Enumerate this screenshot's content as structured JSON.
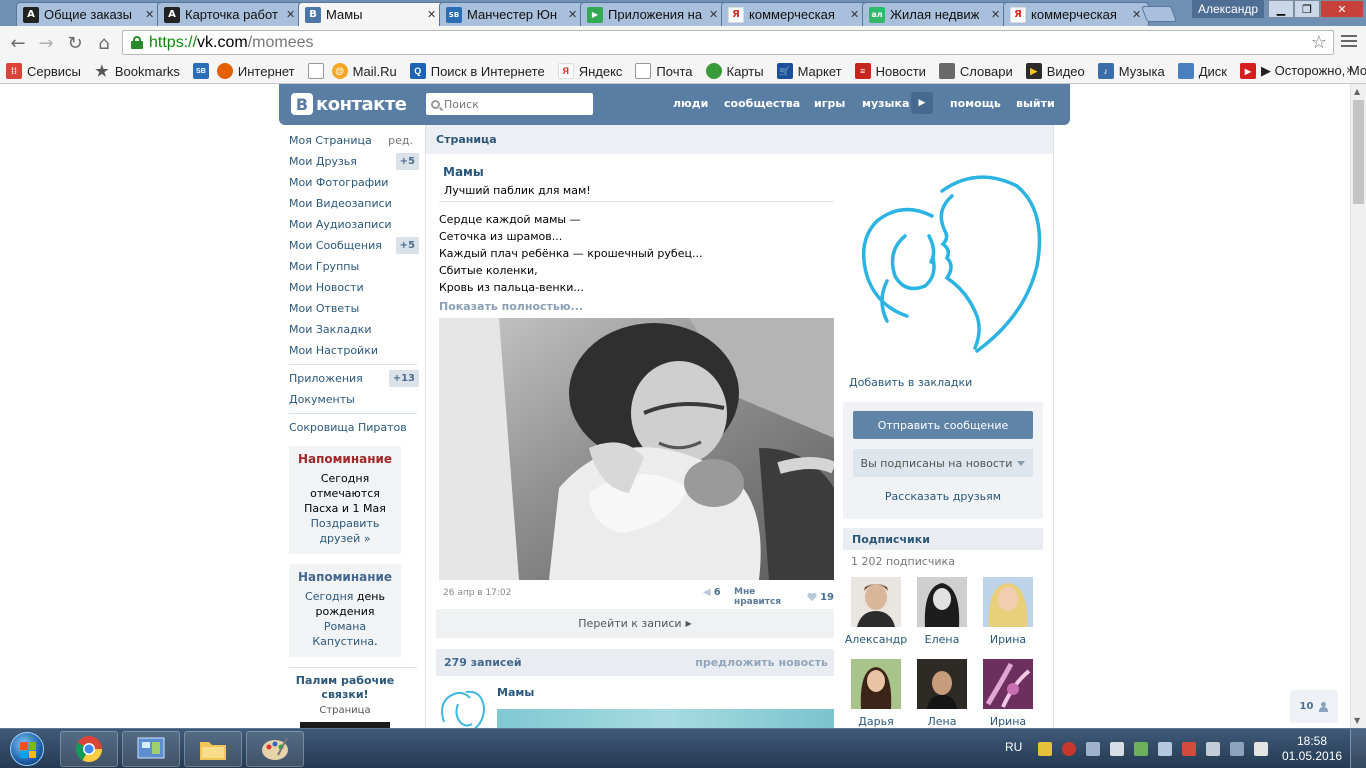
{
  "browser": {
    "tabs": [
      {
        "title": "Общие заказы",
        "icon": "A",
        "icon_color": "#222222",
        "active": false
      },
      {
        "title": "Карточка работ",
        "icon": "A",
        "icon_color": "#222222",
        "active": false
      },
      {
        "title": "Мамы",
        "icon": "В",
        "icon_color": "#4a76a8",
        "active": true
      },
      {
        "title": "Манчестер Юн",
        "icon": "SB",
        "icon_color": "#2a6fb5",
        "active": false
      },
      {
        "title": "Приложения на",
        "icon": "▶",
        "icon_color": "#34a853",
        "active": false
      },
      {
        "title": "коммерческая",
        "icon": "Я",
        "icon_color": "#e52620",
        "active": false
      },
      {
        "title": "Жилая недвиж",
        "icon": "ал",
        "icon_color": "#33b86b",
        "active": false
      },
      {
        "title": "коммерческая",
        "icon": "Я",
        "icon_color": "#e52620",
        "active": false
      }
    ],
    "user": "Александр",
    "url_scheme": "https://",
    "url_host": "vk.com",
    "url_path": "/momees",
    "bookmarks": [
      {
        "label": "Сервисы",
        "icon": "apps-icon",
        "color": "#d64537"
      },
      {
        "label": "Bookmarks",
        "icon": "star-icon",
        "color": "#555555"
      },
      {
        "label": "",
        "icon": "sb-icon",
        "color": "#2a6fb5"
      },
      {
        "label": "Интернет",
        "icon": "firefox-icon",
        "color": "#e66000"
      },
      {
        "label": "",
        "icon": "page-icon",
        "color": "#888888"
      },
      {
        "label": "Mail.Ru",
        "icon": "mailru-icon",
        "color": "#168de2"
      },
      {
        "label": "Поиск в Интернете",
        "icon": "search-icon",
        "color": "#1e63b5"
      },
      {
        "label": "Яндекс",
        "icon": "yandex-icon",
        "color": "#e52620"
      },
      {
        "label": "Почта",
        "icon": "page-icon",
        "color": "#888888"
      },
      {
        "label": "Карты",
        "icon": "maps-icon",
        "color": "#3a9a3a"
      },
      {
        "label": "Маркет",
        "icon": "cart-icon",
        "color": "#1b4f9c"
      },
      {
        "label": "Новости",
        "icon": "news-icon",
        "color": "#c8251e"
      },
      {
        "label": "Словари",
        "icon": "dict-icon",
        "color": "#6a6a6a"
      },
      {
        "label": "Видео",
        "icon": "video-icon",
        "color": "#2b2b2b"
      },
      {
        "label": "Музыка",
        "icon": "music-icon",
        "color": "#3b6ea8"
      },
      {
        "label": "Диск",
        "icon": "disk-icon",
        "color": "#4a80c0"
      },
      {
        "label": "▶ Осторожно, Моде",
        "icon": "youtube-icon",
        "color": "#d51f1f"
      }
    ],
    "bookmarks_more": "»"
  },
  "vk": {
    "logo_letter": "В",
    "logo_text": "контакте",
    "search_placeholder": "Поиск",
    "nav": {
      "people": "люди",
      "communities": "сообщества",
      "games": "игры",
      "music": "музыка",
      "help": "помощь",
      "logout": "выйти"
    },
    "sidebar": {
      "edit": "ред.",
      "items": [
        {
          "label": "Моя Страница",
          "count": ""
        },
        {
          "label": "Мои Друзья",
          "count": "+5"
        },
        {
          "label": "Мои Фотографии",
          "count": ""
        },
        {
          "label": "Мои Видеозаписи",
          "count": ""
        },
        {
          "label": "Мои Аудиозаписи",
          "count": ""
        },
        {
          "label": "Мои Сообщения",
          "count": "+5"
        },
        {
          "label": "Мои Группы",
          "count": ""
        },
        {
          "label": "Мои Новости",
          "count": ""
        },
        {
          "label": "Мои Ответы",
          "count": ""
        },
        {
          "label": "Мои Закладки",
          "count": ""
        },
        {
          "label": "Мои Настройки",
          "count": ""
        }
      ],
      "apps": {
        "label": "Приложения",
        "count": "+13"
      },
      "docs": "Документы",
      "pirates": "Сокровища Пиратов",
      "reminder1": {
        "title": "Напоминание",
        "text": "Сегодня отмечаются Пасха и 1 Мая",
        "link": "Поздравить друзей »"
      },
      "reminder2": {
        "title": "Напоминание",
        "today": "Сегодня",
        "mid": "день рождения",
        "name": "Романа Капустина",
        "end": "."
      },
      "promo": {
        "title": "Палим рабочие связки!",
        "sub": "Страница"
      }
    },
    "content": {
      "crumb": "Страница",
      "page_name": "Мамы",
      "status": "Лучший паблик для мам!",
      "post_lines": [
        "Сердце каждой мамы —",
        "Сеточка из шрамов...",
        "Каждый плач ребёнка — крошечный рубец...",
        "Сбитые коленки,",
        "Кровь из пальца-венки..."
      ],
      "show_more": "Показать полностью...",
      "date": "26 апр в 17:02",
      "reposts": "6",
      "like_label": "Мне нравится",
      "likes": "19",
      "goto": "Перейти к записи",
      "posts_count": "279 записей",
      "suggest": "предложить новость",
      "mini_name": "Мамы"
    },
    "right": {
      "add_bookmark": "Добавить в закладки",
      "send_message": "Отправить сообщение",
      "subscribed": "Вы подписаны на новости",
      "tell_friends": "Рассказать друзьям",
      "subs_title": "Подписчики",
      "subs_count": "1 202 подписчика",
      "subscribers": [
        "Александр",
        "Елена",
        "Ирина",
        "Дарья",
        "Лена",
        "Ирина"
      ]
    },
    "friends_online": "10"
  },
  "taskbar": {
    "lang": "RU",
    "time": "18:58",
    "date": "01.05.2016"
  }
}
